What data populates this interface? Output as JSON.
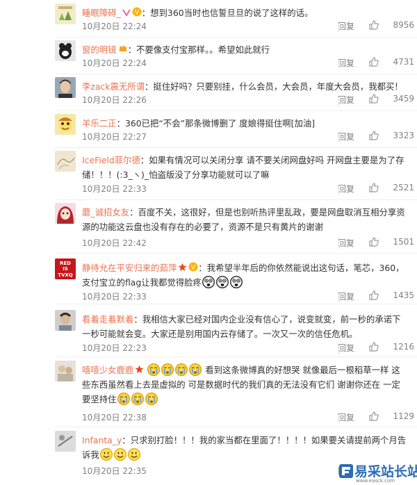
{
  "comments": [
    {
      "name": "睡眠障碍_",
      "badge": "vip",
      "body": "：想到360当时也信誓旦旦的说了这样的话。",
      "time": "10月20日 22:24",
      "reply": "回复",
      "likes": "8956"
    },
    {
      "name": "窗的明镜",
      "badge": "vip",
      "body": "：不要像支付宝那样。。希望如此就行",
      "time": "10月20日 22:24",
      "reply": "回复",
      "likes": "4731"
    },
    {
      "name": "李zack震无所谓",
      "body": "：挺住好吗？只要别挂，什么会员，大会员，年度大会员，我都买！",
      "time": "10月20日 22:26",
      "reply": "回复",
      "likes": "3459"
    },
    {
      "name": "羊乐二正",
      "body": "：360已把“不会”那条微博删了 度娘得挺住啊[加油]",
      "time": "10月20日 22:27",
      "reply": "回复",
      "likes": "3323"
    },
    {
      "name": "IceField菲尔德",
      "body": "：如果有情况可以关闭分享 请不要关闭网盘好吗  开网盘主要是为了存储！！！(:3_ヽ)_怕盗版没了分享功能就可以了嘛",
      "time": "10月20日 22:33",
      "reply": "回复",
      "likes": "2521"
    },
    {
      "name": "蘑_诚招女友",
      "body": "：百度不关，这很好，但是也别听热评里乱政，要是网盘取消互相分享资源的功能这云盘也没有存在的必要了，资源不是只有黄片的谢谢",
      "time": "10月20日 22:42",
      "reply": "回复",
      "likes": "1501"
    },
    {
      "name": "静待允在平安归来的茹萍",
      "badge": "star",
      "body": "：我希望半年后的你依然能说出这句话，笔芯，360，支付宝立的flag让我都觉得脸疼",
      "time": "10月20日 22:33",
      "reply": "回复",
      "likes": "1435"
    },
    {
      "name": "看着走着默着",
      "body": "：我相信大家已经对国内企业没有信心了，说变就变，前一秒的承诺下一秒可能就会变。大家还是别用国内云存储了。一次又一次的信任危机。",
      "time": "10月20日 22:23",
      "reply": "回复",
      "likes": "1216"
    },
    {
      "name": "嘻嘻少女鹿鹿",
      "badge": "star",
      "body_a": "看到这条微博真的好想哭 就像最后一根稻草一样 这些东西虽然看上去是虚拟的 可是数据时代的我们真的无法没有它们 谢谢你还在 一定要坚持住",
      "time": "10月20日 22:38",
      "reply": "回复",
      "likes": "1129"
    },
    {
      "name": "Infanta_y",
      "body": "：只求别打脸！！！我的家当都在里面了！！！！如果要关请提前两个月告诉我",
      "time": "10月20日 22:35",
      "reply": "回复",
      "likes": "1023"
    }
  ],
  "watermark": {
    "brand": "易采站长站",
    "url": "www.easck.com"
  },
  "colors": {
    "name": "#eb7350",
    "meta": "#808080",
    "text": "#333333"
  }
}
